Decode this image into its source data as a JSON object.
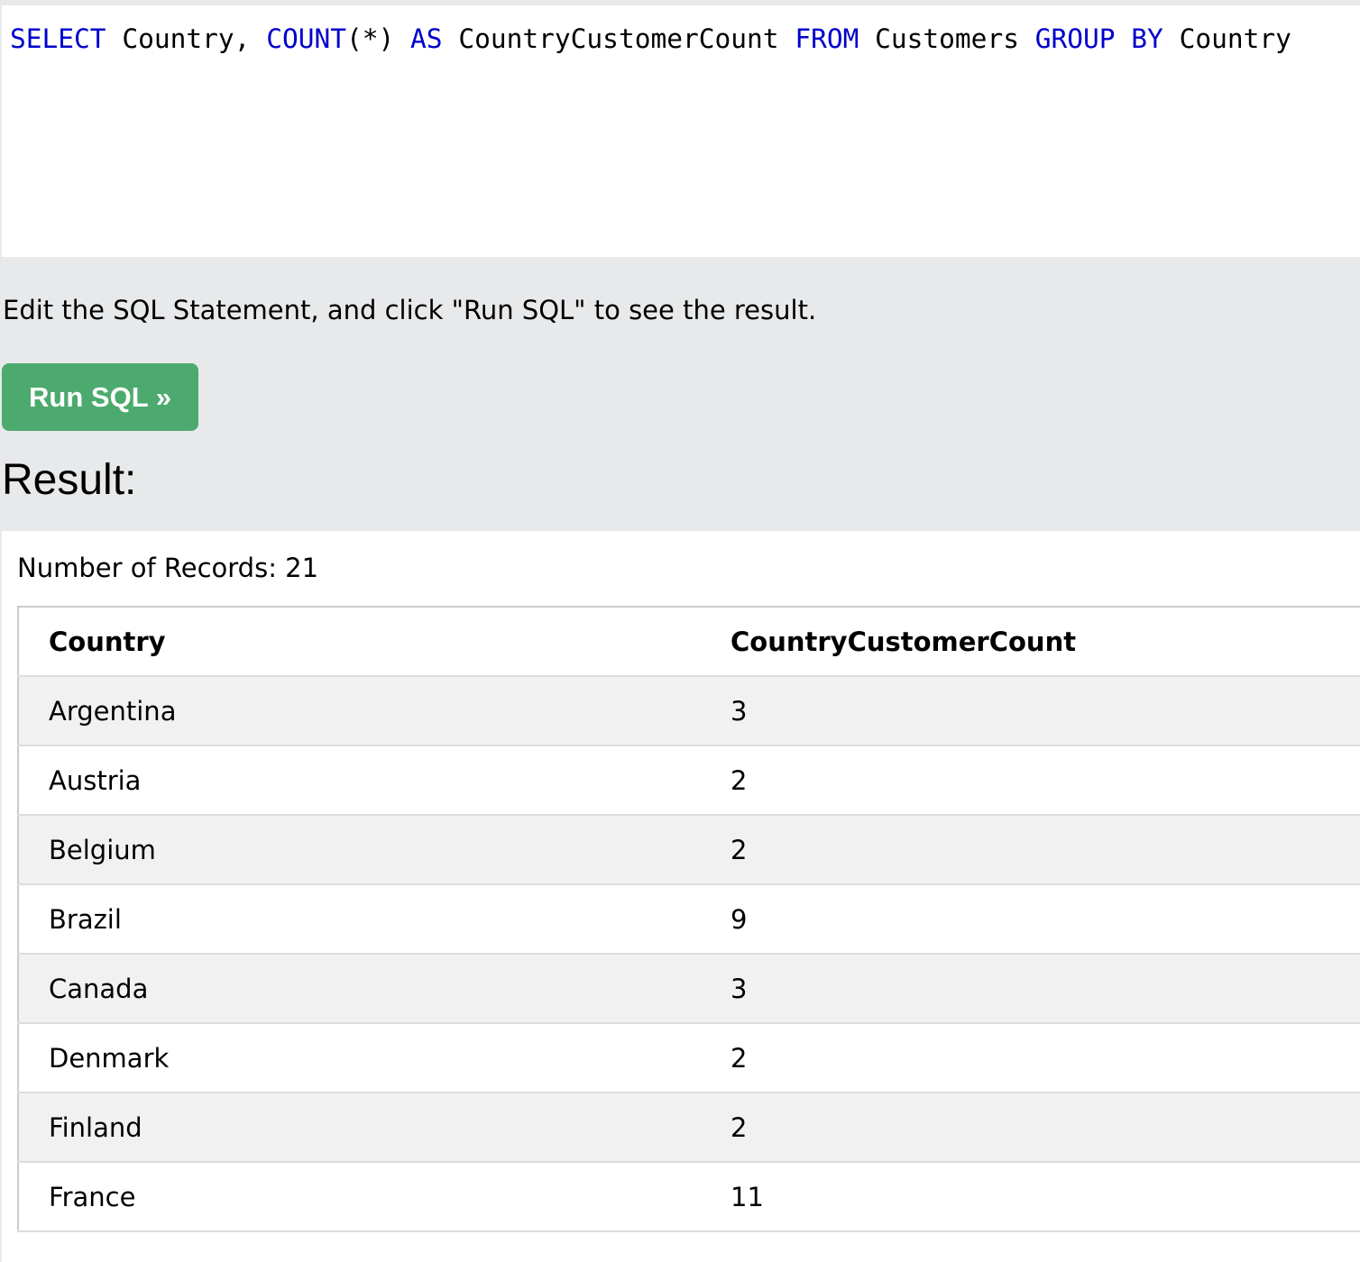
{
  "editor": {
    "tokens": [
      {
        "text": "SELECT",
        "kw": true
      },
      {
        "text": " Country, ",
        "kw": false
      },
      {
        "text": "COUNT",
        "kw": true
      },
      {
        "text": "(*) ",
        "kw": false
      },
      {
        "text": "AS",
        "kw": true
      },
      {
        "text": " CountryCustomerCount ",
        "kw": false
      },
      {
        "text": "FROM",
        "kw": true
      },
      {
        "text": " Customers ",
        "kw": false
      },
      {
        "text": "GROUP BY",
        "kw": true
      },
      {
        "text": " Country",
        "kw": false
      }
    ]
  },
  "instructions": "Edit the SQL Statement, and click \"Run SQL\" to see the result.",
  "run_button_label": "Run SQL »",
  "result": {
    "heading": "Result:",
    "record_count": "Number of Records: 21",
    "columns": [
      "Country",
      "CountryCustomerCount"
    ],
    "rows": [
      [
        "Argentina",
        "3"
      ],
      [
        "Austria",
        "2"
      ],
      [
        "Belgium",
        "2"
      ],
      [
        "Brazil",
        "9"
      ],
      [
        "Canada",
        "3"
      ],
      [
        "Denmark",
        "2"
      ],
      [
        "Finland",
        "2"
      ],
      [
        "France",
        "11"
      ]
    ]
  },
  "colors": {
    "keyword": "#0000cd",
    "button": "#4caa6e",
    "page_background": "#e7e9eb",
    "row_stripe": "#f1f1f1"
  }
}
